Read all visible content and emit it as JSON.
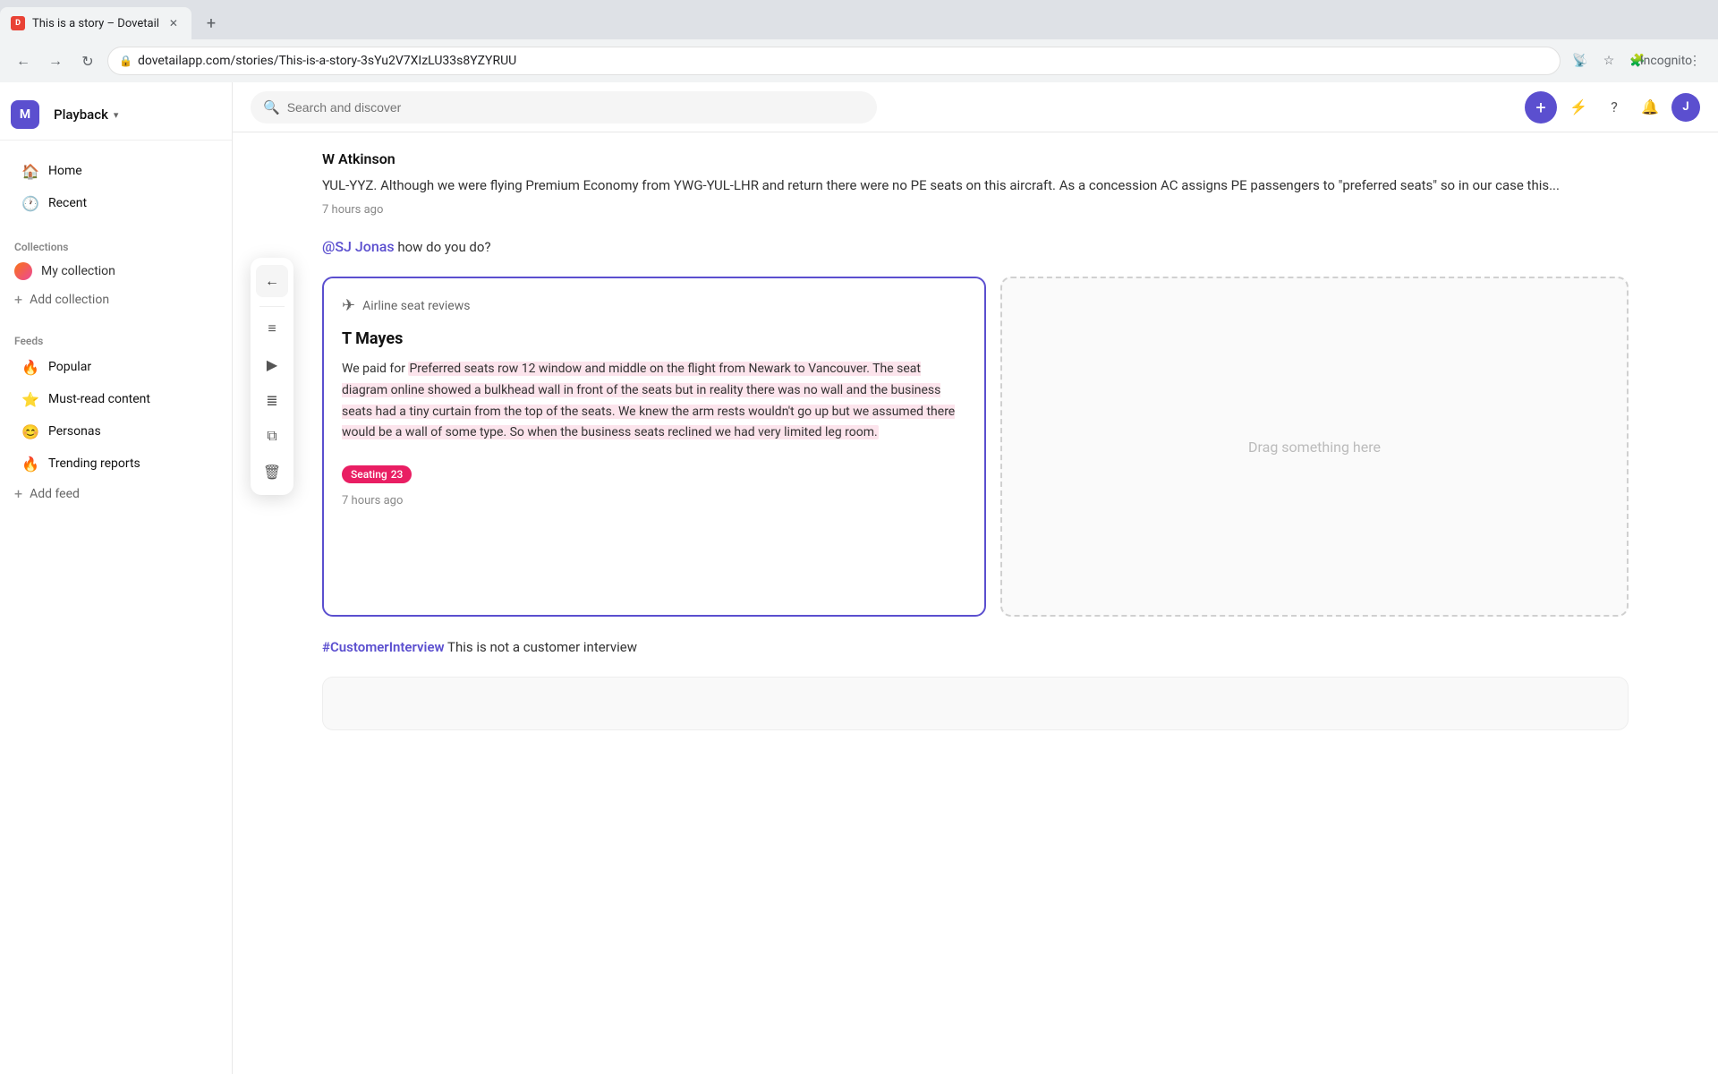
{
  "browser": {
    "tab_title": "This is a story – Dovetail",
    "tab_favicon": "D",
    "url": "dovetailapp.com/stories/This-is-a-story-3sYu2V7XIzLU33s8YZYRUU",
    "new_tab_label": "+",
    "incognito_label": "Incognito"
  },
  "app": {
    "logo_letter": "M",
    "nav_button": "Playback",
    "search_placeholder": "Search and discover"
  },
  "sidebar": {
    "nav_items": [
      {
        "id": "home",
        "label": "Home",
        "icon": "🏠"
      },
      {
        "id": "recent",
        "label": "Recent",
        "icon": "🕐"
      }
    ],
    "collections_section": "Collections",
    "collections": [
      {
        "id": "my-collection",
        "label": "My collection"
      }
    ],
    "add_collection": "Add collection",
    "feeds_section": "Feeds",
    "feeds": [
      {
        "id": "popular",
        "label": "Popular",
        "icon": "🔥"
      },
      {
        "id": "must-read",
        "label": "Must-read content",
        "icon": "⭐"
      },
      {
        "id": "personas",
        "label": "Personas",
        "icon": "😊"
      },
      {
        "id": "trending",
        "label": "Trending reports",
        "icon": "🔥"
      }
    ],
    "add_feed": "Add feed"
  },
  "floating_toolbar": {
    "back_icon": "←",
    "tools": [
      {
        "id": "text",
        "icon": "≡"
      },
      {
        "id": "media",
        "icon": "▶"
      },
      {
        "id": "text-format",
        "icon": "≣"
      },
      {
        "id": "copy",
        "icon": "⧉"
      },
      {
        "id": "delete",
        "icon": "🗑"
      }
    ]
  },
  "content": {
    "author_name": "W Atkinson",
    "author_text": "YUL-YYZ. Although we were flying Premium Economy from YWG-YUL-LHR and return there were no PE seats on this aircraft. As a concession AC assigns PE passengers to \"preferred seats\" so in our case this...",
    "author_timestamp": "7 hours ago",
    "comment_mention": "@SJ Jonas",
    "comment_text": " how do you do?",
    "card": {
      "collection_label": "Airline seat reviews",
      "card_author": "T Mayes",
      "card_body_start": "We paid for ",
      "card_body_highlight": "Preferred seats row 12 window and middle on the flight from Newark to Vancouver. The seat diagram online showed a bulkhead wall in front of the seats but in reality there was no wall and the business seats had a tiny curtain from the top of the seats. We knew the arm rests wouldn't go up but we assumed there would be a wall of some type. So when the business seats reclined we had very limited leg room.",
      "card_body_end": "",
      "tag_label": "Seating",
      "tag_count": "23",
      "card_timestamp": "7 hours ago",
      "drop_zone_hint": "Drag something here"
    },
    "customer_interview": {
      "tag": "#CustomerInterview",
      "text": " This is not a customer interview"
    }
  },
  "top_bar_icons": {
    "add_icon": "+",
    "lightning_icon": "⚡",
    "help_icon": "?",
    "bell_icon": "🔔",
    "user_initial": "J"
  }
}
